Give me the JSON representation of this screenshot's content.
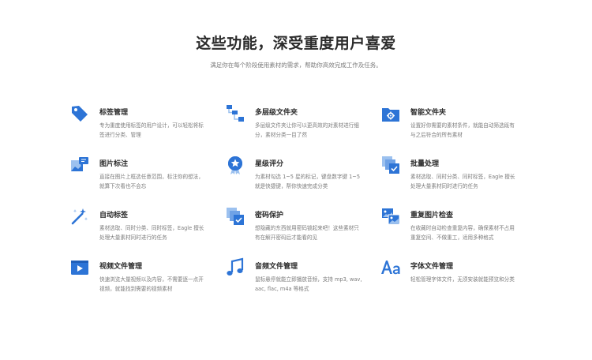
{
  "heading": "这些功能，深受重度用户喜爱",
  "subheading": "满足你在每个阶段使用素材的需求，帮助你高效完成工作及任务。",
  "features": [
    {
      "icon": "tag-icon",
      "title": "标签管理",
      "desc": "专为重度使用标签的用户设计，可以轻松将标签进行分类、管理"
    },
    {
      "icon": "folder-tree-icon",
      "title": "多层级文件夹",
      "desc": "多层级文件夹让你可以更高效的对素材进行细分，素材分类一目了然"
    },
    {
      "icon": "smart-folder-icon",
      "title": "智能文件夹",
      "desc": "设置好你需要的素材条件，就能自动筛选既有与之后符合的所有素材"
    },
    {
      "icon": "image-annotation-icon",
      "title": "图片标注",
      "desc": "直接在图片上框选任意范围，标注你的想法，就算下次看也不会忘"
    },
    {
      "icon": "star-badge-icon",
      "title": "星级评分",
      "desc": "为素材勾选 1~5 星的标记，键盘数字键 1~5 就是快捷键，帮你快速完成分类"
    },
    {
      "icon": "batch-process-icon",
      "title": "批量处理",
      "desc": "素材选取、同时分类、同时标签，Eagle 擅长处理大量素材同时进行的任务"
    },
    {
      "icon": "magic-wand-icon",
      "title": "自动标签",
      "desc": "素材选取、同时分类、同时标签，Eagle 擅长处理大量素材同时进行的任务"
    },
    {
      "icon": "lock-folder-icon",
      "title": "密码保护",
      "desc": "想隐藏的东西就用密码锁起来吧！这些素材只有在解开密码后才能看的见"
    },
    {
      "icon": "duplicate-images-icon",
      "title": "重复图片检查",
      "desc": "在收藏时自动检查重复内容，确保素材不占用重复空间、不做重工，适用多种格式"
    },
    {
      "icon": "video-file-icon",
      "title": "视频文件管理",
      "desc": "快速浏览大量视频以及内容，不需要逐一点开视频，就能找到需要的视频素材"
    },
    {
      "icon": "music-note-icon",
      "title": "音频文件管理",
      "desc": "鼠标悬停就能立即播放音频，支持 mp3, wav, aac, flac, m4a 等格式"
    },
    {
      "icon": "font-icon",
      "title": "字体文件管理",
      "desc": "轻松管理字体文件，无须安装就能预览和分类"
    }
  ],
  "colors": {
    "primary": "#2d74d6",
    "light": "#9cc1ef",
    "title": "#2b2b2b",
    "text": "#7c7c7c"
  }
}
